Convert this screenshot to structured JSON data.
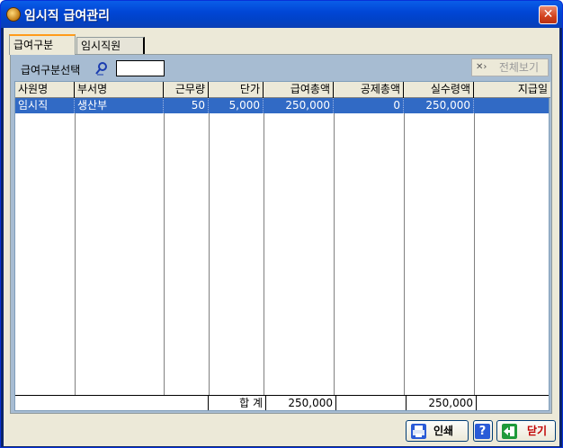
{
  "window": {
    "title": "임시직 급여관리"
  },
  "tabs": [
    {
      "label": "급여구분",
      "active": true
    },
    {
      "label": "임시직원",
      "active": false
    }
  ],
  "filter": {
    "label": "급여구분선택",
    "value": ""
  },
  "toolbar": {
    "show_all_label": "전체보기"
  },
  "grid": {
    "columns": [
      "사원명",
      "부서명",
      "근무량",
      "단가",
      "급여총액",
      "공제총액",
      "실수령액",
      "지급일"
    ],
    "rows": [
      [
        "임시직",
        "생산부",
        "50",
        "5,000",
        "250,000",
        "0",
        "250,000",
        ""
      ]
    ],
    "total": {
      "label": "합 계",
      "pay_total": "250,000",
      "deduction_total": "",
      "net_total": "250,000"
    }
  },
  "buttons": {
    "print": "인쇄",
    "help": "?",
    "close": "닫기"
  },
  "colors": {
    "selection": "#316ac5",
    "panel": "#a7bcd2",
    "accent": "#ff9b1a"
  }
}
